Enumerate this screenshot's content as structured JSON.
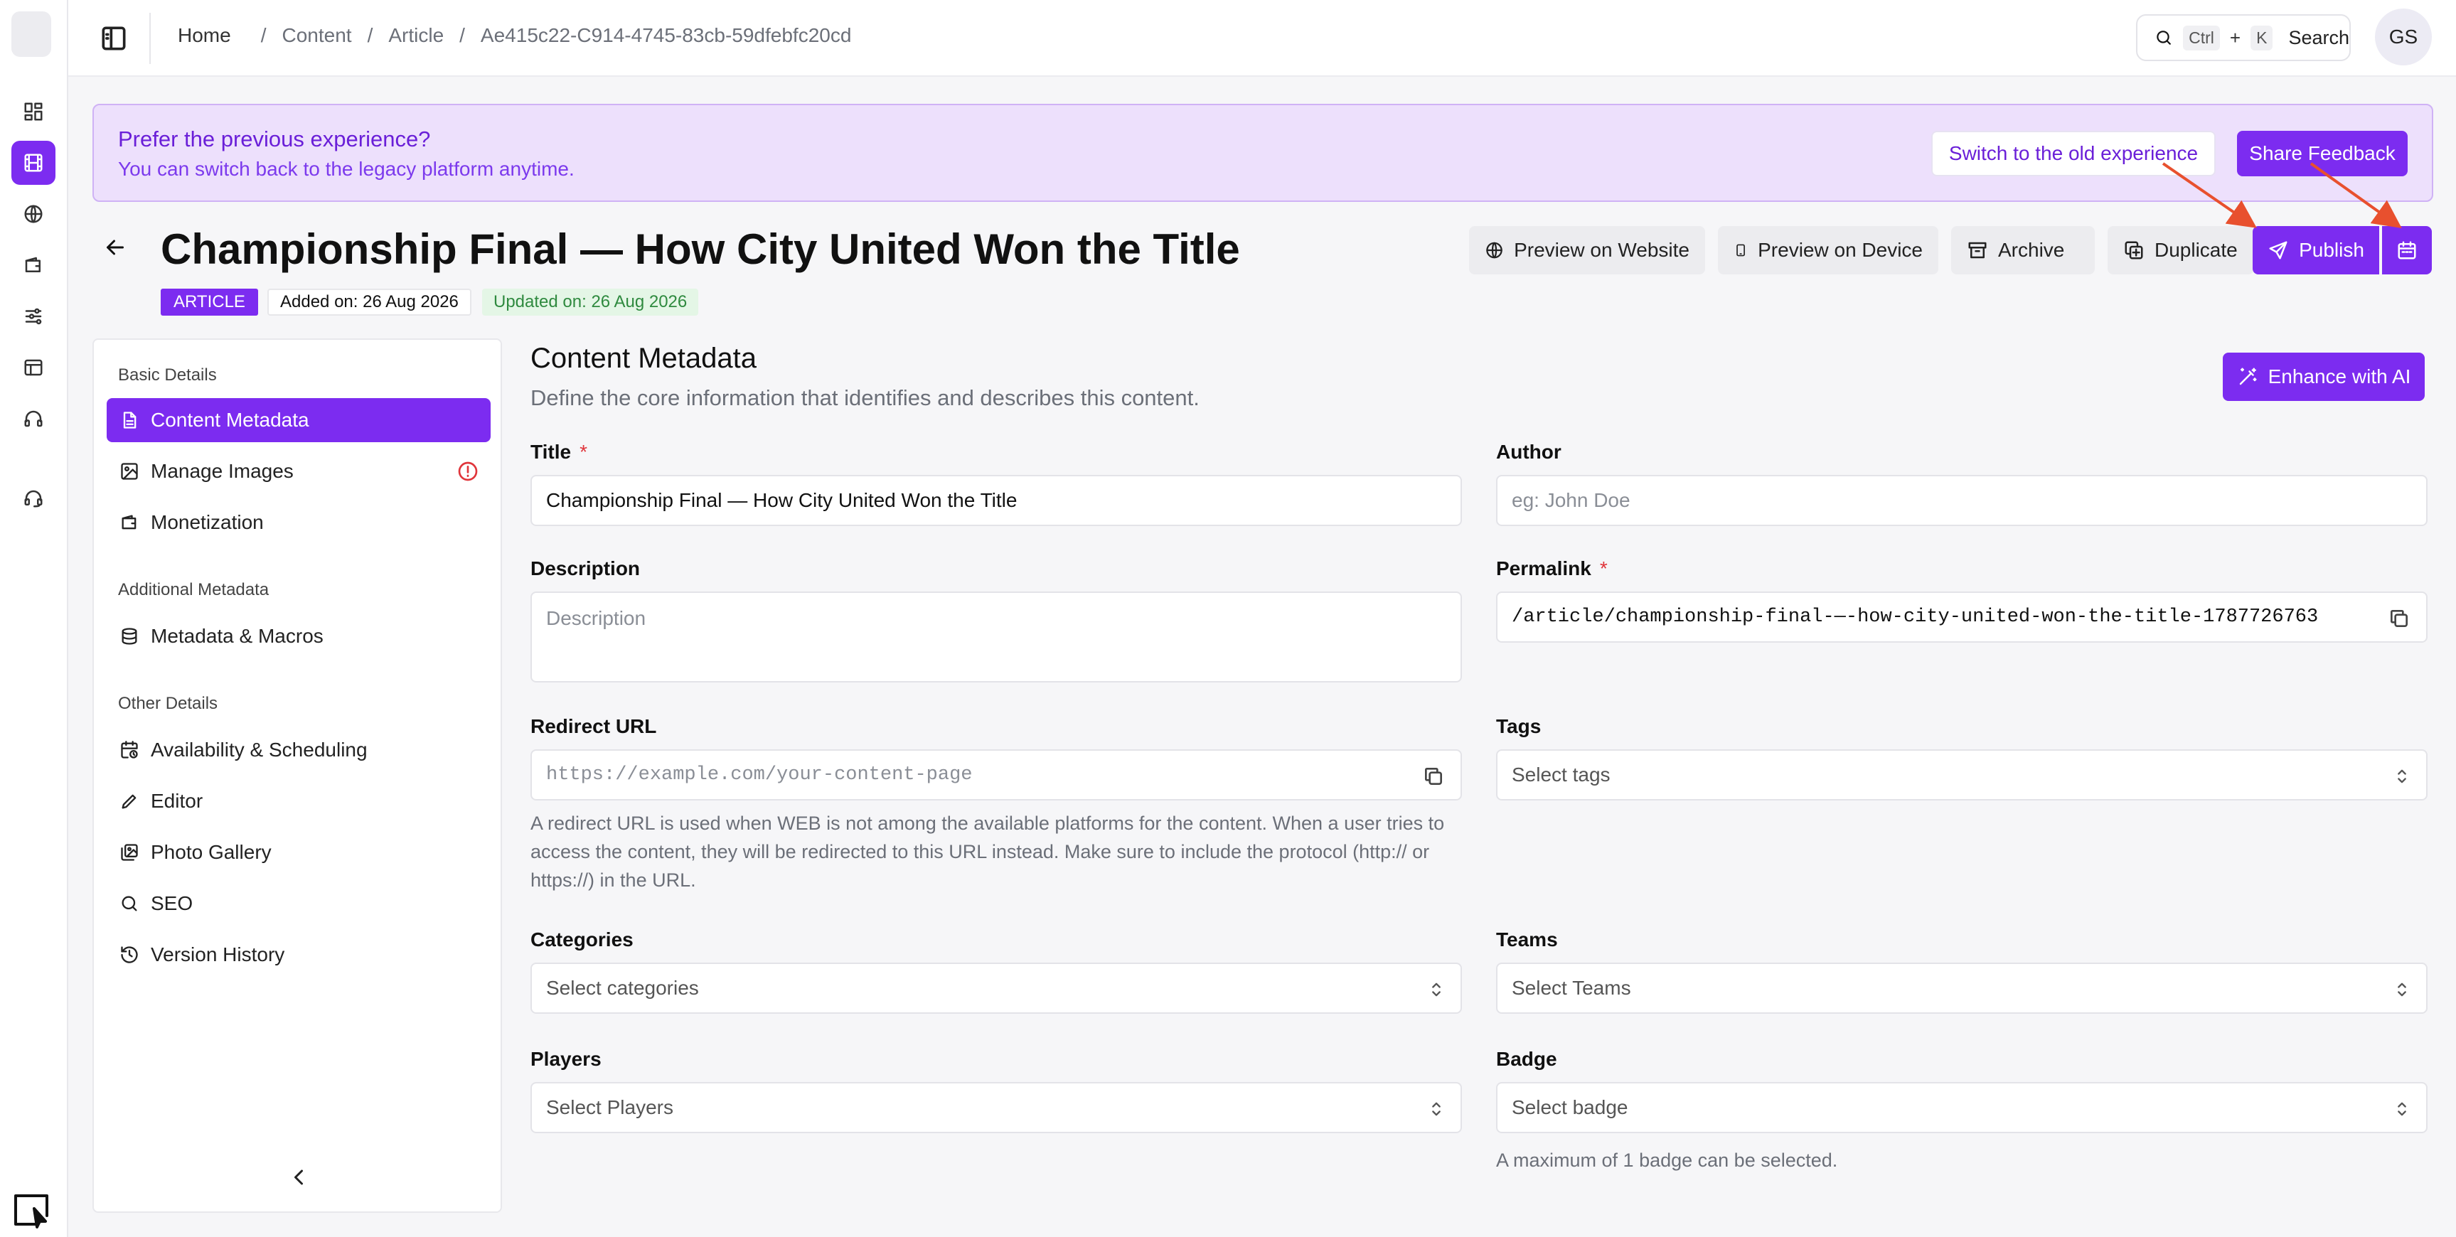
{
  "topbar": {
    "breadcrumbs": [
      "Home",
      "Content",
      "Article",
      "Ae415c22-C914-4745-83cb-59dfebfc20cd"
    ],
    "search": {
      "kbd1": "Ctrl",
      "plus": "+",
      "kbd2": "K",
      "label": "Search"
    },
    "avatar": "GS"
  },
  "banner": {
    "title": "Prefer the previous experience?",
    "subtitle": "You can switch back to the legacy platform anytime.",
    "switch_label": "Switch to the old experience",
    "feedback_label": "Share Feedback"
  },
  "header": {
    "title": "Championship Final — How City United Won the Title",
    "type_badge": "ARTICLE",
    "added": "Added on: 26 Aug 2026",
    "updated": "Updated on: 26 Aug 2026",
    "actions": {
      "preview_website": "Preview on Website",
      "preview_device": "Preview on Device",
      "archive": "Archive",
      "duplicate": "Duplicate",
      "publish": "Publish"
    }
  },
  "sidebar": {
    "sections": [
      "Basic Details",
      "Additional Metadata",
      "Other Details"
    ],
    "items": [
      {
        "label": "Content Metadata",
        "icon": "document-icon",
        "active": true
      },
      {
        "label": "Manage Images",
        "icon": "image-icon",
        "warning": true
      },
      {
        "label": "Monetization",
        "icon": "wallet-icon"
      },
      {
        "label": "Metadata & Macros",
        "icon": "database-icon"
      },
      {
        "label": "Availability & Scheduling",
        "icon": "calendar-clock-icon"
      },
      {
        "label": "Editor",
        "icon": "pencil-icon"
      },
      {
        "label": "Photo Gallery",
        "icon": "gallery-icon"
      },
      {
        "label": "SEO",
        "icon": "search-icon"
      },
      {
        "label": "Version History",
        "icon": "history-icon"
      }
    ]
  },
  "main": {
    "title": "Content Metadata",
    "subtitle": "Define the core information that identifies and describes this content.",
    "enhance_label": "Enhance with AI",
    "fields": {
      "title": {
        "label": "Title",
        "value": "Championship Final — How City United Won the Title",
        "required": "*"
      },
      "author": {
        "label": "Author",
        "placeholder": "eg: John Doe"
      },
      "description": {
        "label": "Description",
        "placeholder": "Description"
      },
      "permalink": {
        "label": "Permalink",
        "value": "/article/championship-final-—-how-city-united-won-the-title-1787726763",
        "required": "*"
      },
      "redirect": {
        "label": "Redirect URL",
        "placeholder": "https://example.com/your-content-page",
        "help": "A redirect URL is used when WEB is not among the available platforms for the content. When a user tries to access the content, they will be redirected to this URL instead. Make sure to include the protocol (http:// or https://) in the URL."
      },
      "tags": {
        "label": "Tags",
        "placeholder": "Select tags"
      },
      "categories": {
        "label": "Categories",
        "placeholder": "Select categories"
      },
      "teams": {
        "label": "Teams",
        "placeholder": "Select Teams"
      },
      "players": {
        "label": "Players",
        "placeholder": "Select Players"
      },
      "badge": {
        "label": "Badge",
        "placeholder": "Select badge",
        "help": "A maximum of 1 badge can be selected."
      }
    }
  },
  "colors": {
    "accent": "#7c2cf0",
    "banner_bg": "#ede0fc",
    "annotation_arrow": "#e8502e",
    "required": "#e0353b"
  }
}
